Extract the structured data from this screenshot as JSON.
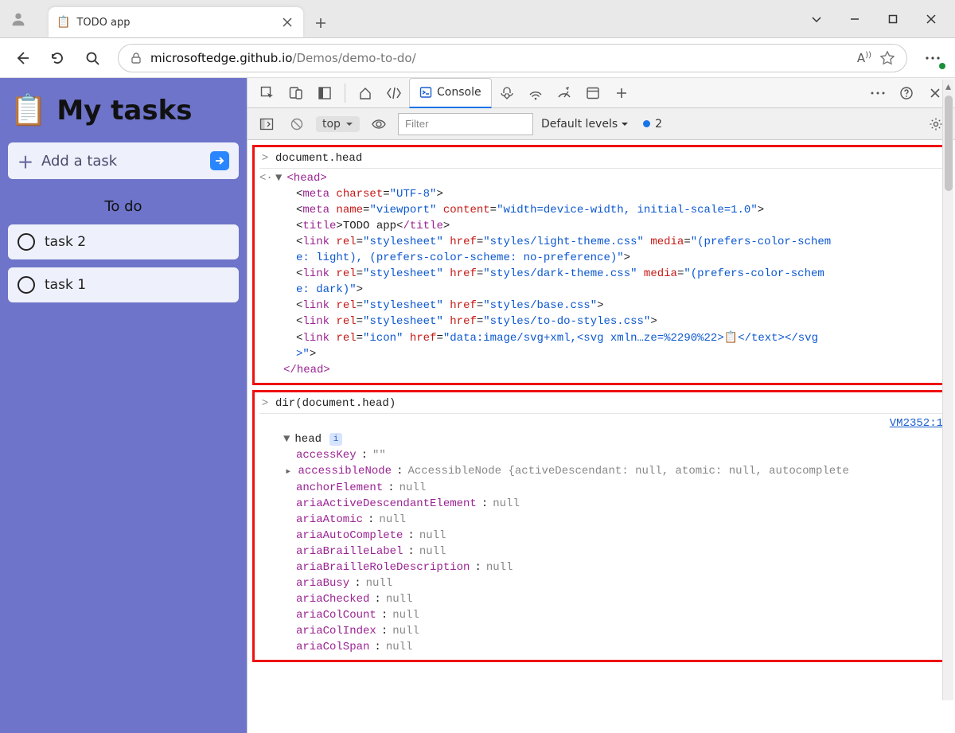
{
  "browser": {
    "tab_title": "TODO app",
    "url_host": "microsoftedge.github.io",
    "url_path": "/Demos/demo-to-do/"
  },
  "app": {
    "header_icon": "📋",
    "header_title": "My tasks",
    "add_task_label": "Add a task",
    "section_label": "To do",
    "tasks": [
      "task 2",
      "task 1"
    ]
  },
  "devtools": {
    "tabs_console_label": "Console",
    "context_label": "top",
    "filter_placeholder": "Filter",
    "levels_label": "Default levels",
    "issue_count": "2"
  },
  "console": {
    "input1": "document.head",
    "out1": {
      "head_open": "<head>",
      "lines": [
        {
          "segments": [
            {
              "t": "<",
              "c": "black"
            },
            {
              "t": "meta ",
              "c": "purple"
            },
            {
              "t": "charset",
              "c": "red"
            },
            {
              "t": "=",
              "c": "black"
            },
            {
              "t": "\"UTF-8\"",
              "c": "blue"
            },
            {
              "t": ">",
              "c": "black"
            }
          ]
        },
        {
          "segments": [
            {
              "t": "<",
              "c": "black"
            },
            {
              "t": "meta ",
              "c": "purple"
            },
            {
              "t": "name",
              "c": "red"
            },
            {
              "t": "=",
              "c": "black"
            },
            {
              "t": "\"viewport\" ",
              "c": "blue"
            },
            {
              "t": "content",
              "c": "red"
            },
            {
              "t": "=",
              "c": "black"
            },
            {
              "t": "\"width=device-width, initial-scale=1.0\"",
              "c": "blue"
            },
            {
              "t": ">",
              "c": "black"
            }
          ]
        },
        {
          "segments": [
            {
              "t": "<",
              "c": "black"
            },
            {
              "t": "title",
              "c": "purple"
            },
            {
              "t": ">",
              "c": "black"
            },
            {
              "t": "TODO app",
              "c": "black"
            },
            {
              "t": "<",
              "c": "black"
            },
            {
              "t": "/title",
              "c": "purple"
            },
            {
              "t": ">",
              "c": "black"
            }
          ]
        },
        {
          "segments": [
            {
              "t": "<",
              "c": "black"
            },
            {
              "t": "link ",
              "c": "purple"
            },
            {
              "t": "rel",
              "c": "red"
            },
            {
              "t": "=",
              "c": "black"
            },
            {
              "t": "\"stylesheet\" ",
              "c": "blue"
            },
            {
              "t": "href",
              "c": "red"
            },
            {
              "t": "=",
              "c": "black"
            },
            {
              "t": "\"styles/light-theme.css\" ",
              "c": "blue"
            },
            {
              "t": "media",
              "c": "red"
            },
            {
              "t": "=",
              "c": "black"
            },
            {
              "t": "\"(prefers-color-schem",
              "c": "blue"
            }
          ]
        },
        {
          "segments": [
            {
              "t": "e: light), (prefers-color-scheme: no-preference)\"",
              "c": "blue"
            },
            {
              "t": ">",
              "c": "black"
            }
          ]
        },
        {
          "segments": [
            {
              "t": "<",
              "c": "black"
            },
            {
              "t": "link ",
              "c": "purple"
            },
            {
              "t": "rel",
              "c": "red"
            },
            {
              "t": "=",
              "c": "black"
            },
            {
              "t": "\"stylesheet\" ",
              "c": "blue"
            },
            {
              "t": "href",
              "c": "red"
            },
            {
              "t": "=",
              "c": "black"
            },
            {
              "t": "\"styles/dark-theme.css\" ",
              "c": "blue"
            },
            {
              "t": "media",
              "c": "red"
            },
            {
              "t": "=",
              "c": "black"
            },
            {
              "t": "\"(prefers-color-schem",
              "c": "blue"
            }
          ]
        },
        {
          "segments": [
            {
              "t": "e: dark)\"",
              "c": "blue"
            },
            {
              "t": ">",
              "c": "black"
            }
          ]
        },
        {
          "segments": [
            {
              "t": "<",
              "c": "black"
            },
            {
              "t": "link ",
              "c": "purple"
            },
            {
              "t": "rel",
              "c": "red"
            },
            {
              "t": "=",
              "c": "black"
            },
            {
              "t": "\"stylesheet\" ",
              "c": "blue"
            },
            {
              "t": "href",
              "c": "red"
            },
            {
              "t": "=",
              "c": "black"
            },
            {
              "t": "\"styles/base.css\"",
              "c": "blue"
            },
            {
              "t": ">",
              "c": "black"
            }
          ]
        },
        {
          "segments": [
            {
              "t": "<",
              "c": "black"
            },
            {
              "t": "link ",
              "c": "purple"
            },
            {
              "t": "rel",
              "c": "red"
            },
            {
              "t": "=",
              "c": "black"
            },
            {
              "t": "\"stylesheet\" ",
              "c": "blue"
            },
            {
              "t": "href",
              "c": "red"
            },
            {
              "t": "=",
              "c": "black"
            },
            {
              "t": "\"styles/to-do-styles.css\"",
              "c": "blue"
            },
            {
              "t": ">",
              "c": "black"
            }
          ]
        },
        {
          "segments": [
            {
              "t": "<",
              "c": "black"
            },
            {
              "t": "link ",
              "c": "purple"
            },
            {
              "t": "rel",
              "c": "red"
            },
            {
              "t": "=",
              "c": "black"
            },
            {
              "t": "\"icon\" ",
              "c": "blue"
            },
            {
              "t": "href",
              "c": "red"
            },
            {
              "t": "=",
              "c": "black"
            },
            {
              "t": "\"data:image/svg+xml,<svg xmln…ze=%2290%22>",
              "c": "blue"
            },
            {
              "t": "📋",
              "c": "black"
            },
            {
              "t": "</text></svg",
              "c": "blue"
            }
          ]
        },
        {
          "segments": [
            {
              "t": ">\"",
              "c": "blue"
            },
            {
              "t": ">",
              "c": "black"
            }
          ]
        }
      ],
      "head_close": "</head>"
    },
    "input2": "dir(document.head)",
    "vm_link": "VM2352:1",
    "out2": {
      "head_label": "head",
      "props": [
        {
          "k": "accessKey",
          "v": "\"\""
        },
        {
          "k": "accessibleNode",
          "v": "AccessibleNode {activeDescendant: null, atomic: null, autocomplete",
          "expand": true,
          "grey": true
        },
        {
          "k": "anchorElement",
          "v": "null"
        },
        {
          "k": "ariaActiveDescendantElement",
          "v": "null"
        },
        {
          "k": "ariaAtomic",
          "v": "null"
        },
        {
          "k": "ariaAutoComplete",
          "v": "null"
        },
        {
          "k": "ariaBrailleLabel",
          "v": "null"
        },
        {
          "k": "ariaBrailleRoleDescription",
          "v": "null"
        },
        {
          "k": "ariaBusy",
          "v": "null"
        },
        {
          "k": "ariaChecked",
          "v": "null"
        },
        {
          "k": "ariaColCount",
          "v": "null"
        },
        {
          "k": "ariaColIndex",
          "v": "null"
        },
        {
          "k": "ariaColSpan",
          "v": "null"
        }
      ]
    }
  }
}
